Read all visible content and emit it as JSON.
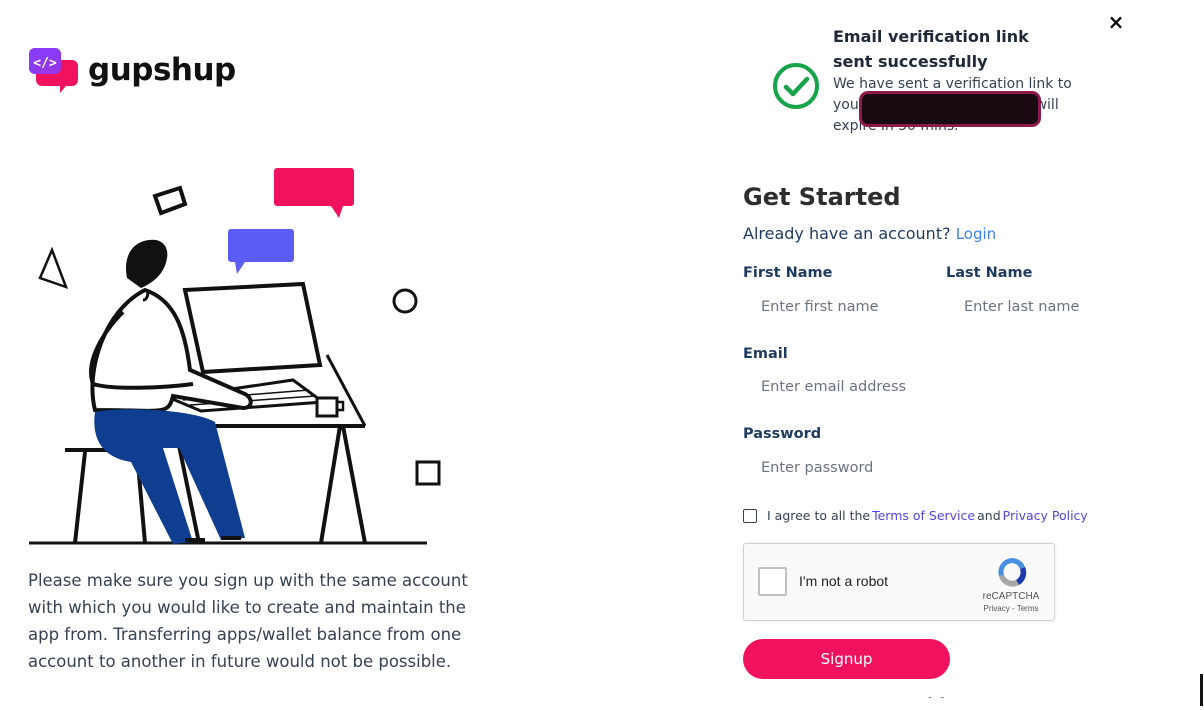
{
  "brand": {
    "name": "gupshup",
    "logo_glyph": "</>",
    "accent": "#f0125e",
    "purple": "#5b5cf6"
  },
  "toast": {
    "title": "Email verification link sent successfully",
    "message": "We have sent a verification link to your email address. The link will expire in 30 mins.",
    "close_label": "×",
    "icon": "check-circle-icon",
    "icon_color": "#16a34a"
  },
  "form": {
    "heading": "Get Started",
    "already_text": "Already have an account?",
    "login_link": "Login",
    "first_name_label": "First Name",
    "first_name_placeholder": "Enter first name",
    "last_name_label": "Last Name",
    "last_name_placeholder": "Enter last name",
    "email_label": "Email",
    "email_placeholder": "Enter email address",
    "password_label": "Password",
    "password_placeholder": "Enter password",
    "agree_text": "I agree to all the",
    "terms_link": "Terms of Service",
    "and_text": "and",
    "privacy_link": "Privacy Policy",
    "signup_label": "Signup"
  },
  "captcha": {
    "label": "I'm not a robot",
    "brand": "reCAPTCHA",
    "links": "Privacy - Terms"
  },
  "note": "Please make sure you sign up with the same account with which you would like to create and maintain the app from. Transferring apps/wallet balance from one account to another in future would not be possible.",
  "footer_dashes": "- -"
}
